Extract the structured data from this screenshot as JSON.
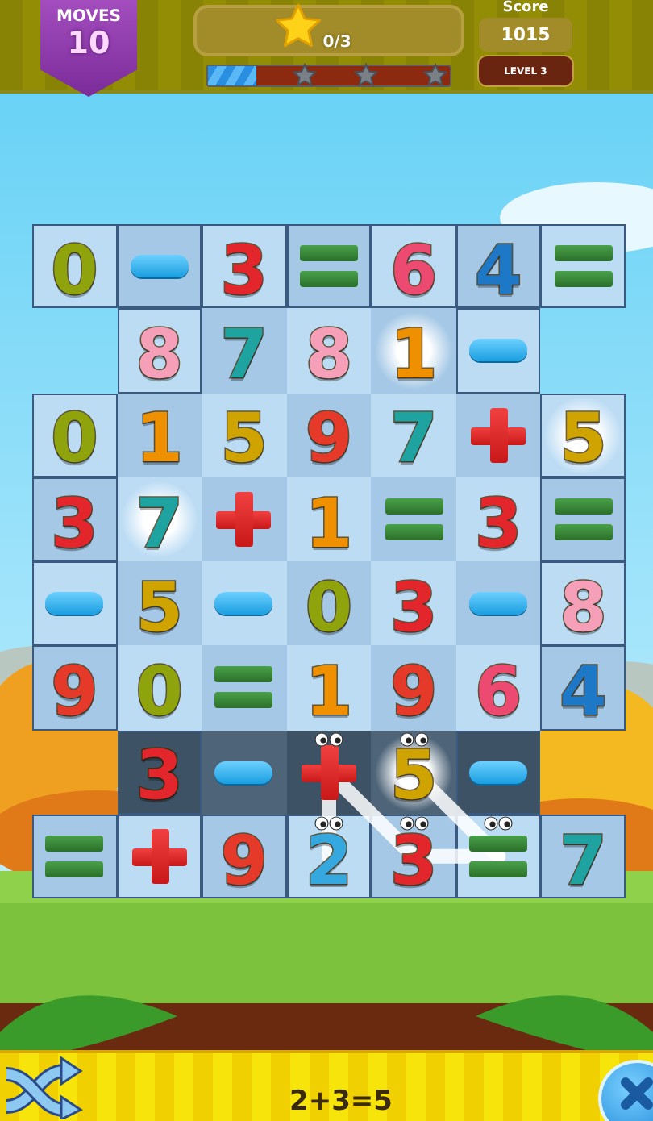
{
  "top_bar": {
    "moves": {
      "label": "MOVES",
      "value": "10"
    },
    "stars_panel": {
      "count": "0/3"
    },
    "progress": {
      "level": 0.2,
      "milestones": [
        {
          "earned": false
        },
        {
          "earned": false
        },
        {
          "earned": false
        }
      ]
    },
    "score": {
      "label": "Score",
      "value": "1015"
    },
    "level_badge": "LEVEL 3"
  },
  "board": {
    "rows": [
      {
        "shaded": false,
        "tiles": [
          {
            "kind": "digit",
            "text": "0",
            "color": "#8fa30c",
            "sparkle": false,
            "selected": false
          },
          {
            "kind": "minus",
            "sparkle": false,
            "selected": false
          },
          {
            "kind": "digit",
            "text": "3",
            "color": "#e3262b",
            "sparkle": false,
            "selected": false
          },
          {
            "kind": "equals",
            "sparkle": false,
            "selected": false
          },
          {
            "kind": "digit",
            "text": "6",
            "color": "#ec4a70",
            "sparkle": false,
            "selected": false
          },
          {
            "kind": "digit",
            "text": "4",
            "color": "#1e78c8",
            "sparkle": false,
            "selected": false
          },
          {
            "kind": "equals",
            "sparkle": false,
            "selected": false
          }
        ]
      },
      {
        "shaded": false,
        "tiles": [
          {
            "kind": "empty"
          },
          {
            "kind": "digit",
            "text": "8",
            "color": "#f5a0b8",
            "sparkle": false,
            "selected": false
          },
          {
            "kind": "digit",
            "text": "7",
            "color": "#1fa3a0",
            "sparkle": false,
            "selected": false
          },
          {
            "kind": "digit",
            "text": "8",
            "color": "#f5a0b8",
            "sparkle": false,
            "selected": false
          },
          {
            "kind": "digit",
            "text": "1",
            "color": "#ee9000",
            "sparkle": true,
            "selected": false
          },
          {
            "kind": "minus",
            "sparkle": false,
            "selected": false
          },
          {
            "kind": "empty"
          }
        ]
      },
      {
        "shaded": false,
        "tiles": [
          {
            "kind": "digit",
            "text": "0",
            "color": "#8fa30c",
            "sparkle": false,
            "selected": false
          },
          {
            "kind": "digit",
            "text": "1",
            "color": "#ee9000",
            "sparkle": false,
            "selected": false
          },
          {
            "kind": "digit",
            "text": "5",
            "color": "#d0a400",
            "sparkle": false,
            "selected": false
          },
          {
            "kind": "digit",
            "text": "9",
            "color": "#e53a2a",
            "sparkle": false,
            "selected": false
          },
          {
            "kind": "digit",
            "text": "7",
            "color": "#1fa3a0",
            "sparkle": false,
            "selected": false
          },
          {
            "kind": "plus",
            "sparkle": false,
            "selected": false
          },
          {
            "kind": "digit",
            "text": "5",
            "color": "#d0a400",
            "sparkle": true,
            "selected": false
          }
        ]
      },
      {
        "shaded": false,
        "tiles": [
          {
            "kind": "digit",
            "text": "3",
            "color": "#e3262b",
            "sparkle": false,
            "selected": false
          },
          {
            "kind": "digit",
            "text": "7",
            "color": "#1fa3a0",
            "sparkle": true,
            "selected": false
          },
          {
            "kind": "plus",
            "sparkle": false,
            "selected": false
          },
          {
            "kind": "digit",
            "text": "1",
            "color": "#ee9000",
            "sparkle": false,
            "selected": false
          },
          {
            "kind": "equals",
            "sparkle": false,
            "selected": false
          },
          {
            "kind": "digit",
            "text": "3",
            "color": "#e3262b",
            "sparkle": false,
            "selected": false
          },
          {
            "kind": "equals",
            "sparkle": false,
            "selected": false
          }
        ]
      },
      {
        "shaded": false,
        "tiles": [
          {
            "kind": "minus",
            "sparkle": false,
            "selected": false
          },
          {
            "kind": "digit",
            "text": "5",
            "color": "#d0a400",
            "sparkle": false,
            "selected": false
          },
          {
            "kind": "minus",
            "sparkle": false,
            "selected": false
          },
          {
            "kind": "digit",
            "text": "0",
            "color": "#8fa30c",
            "sparkle": false,
            "selected": false
          },
          {
            "kind": "digit",
            "text": "3",
            "color": "#e3262b",
            "sparkle": false,
            "selected": false
          },
          {
            "kind": "minus",
            "sparkle": false,
            "selected": false
          },
          {
            "kind": "digit",
            "text": "8",
            "color": "#f5a0b8",
            "sparkle": false,
            "selected": false
          }
        ]
      },
      {
        "shaded": false,
        "tiles": [
          {
            "kind": "digit",
            "text": "9",
            "color": "#e53a2a",
            "sparkle": false,
            "selected": false
          },
          {
            "kind": "digit",
            "text": "0",
            "color": "#8fa30c",
            "sparkle": false,
            "selected": false
          },
          {
            "kind": "equals",
            "sparkle": false,
            "selected": false
          },
          {
            "kind": "digit",
            "text": "1",
            "color": "#ee9000",
            "sparkle": false,
            "selected": false
          },
          {
            "kind": "digit",
            "text": "9",
            "color": "#e53a2a",
            "sparkle": false,
            "selected": false
          },
          {
            "kind": "digit",
            "text": "6",
            "color": "#ec4a70",
            "sparkle": false,
            "selected": false
          },
          {
            "kind": "digit",
            "text": "4",
            "color": "#1e78c8",
            "sparkle": false,
            "selected": false
          }
        ]
      },
      {
        "shaded": true,
        "tiles": [
          {
            "kind": "empty"
          },
          {
            "kind": "digit",
            "text": "3",
            "color": "#e3262b",
            "sparkle": false,
            "selected": false
          },
          {
            "kind": "minus",
            "sparkle": false,
            "selected": false
          },
          {
            "kind": "plus",
            "sparkle": false,
            "selected": true,
            "link_down_right": true
          },
          {
            "kind": "digit",
            "text": "5",
            "color": "#d0a400",
            "sparkle": true,
            "selected": true
          },
          {
            "kind": "minus",
            "sparkle": false,
            "selected": false
          },
          {
            "kind": "empty"
          }
        ]
      },
      {
        "shaded": false,
        "tiles": [
          {
            "kind": "equals",
            "sparkle": false,
            "selected": false
          },
          {
            "kind": "plus",
            "sparkle": false,
            "selected": false
          },
          {
            "kind": "digit",
            "text": "9",
            "color": "#e53a2a",
            "sparkle": false,
            "selected": false
          },
          {
            "kind": "digit",
            "text": "2",
            "color": "#35a8e0",
            "sparkle": false,
            "selected": true,
            "link_up": true
          },
          {
            "kind": "digit",
            "text": "3",
            "color": "#e3262b",
            "sparkle": false,
            "selected": true,
            "link_right": true
          },
          {
            "kind": "equals",
            "sparkle": false,
            "selected": true,
            "link_up_left": true
          },
          {
            "kind": "digit",
            "text": "7",
            "color": "#1fa3a0",
            "sparkle": false,
            "selected": false
          }
        ]
      }
    ]
  },
  "bottom_bar": {
    "equation": "2+3=5"
  }
}
